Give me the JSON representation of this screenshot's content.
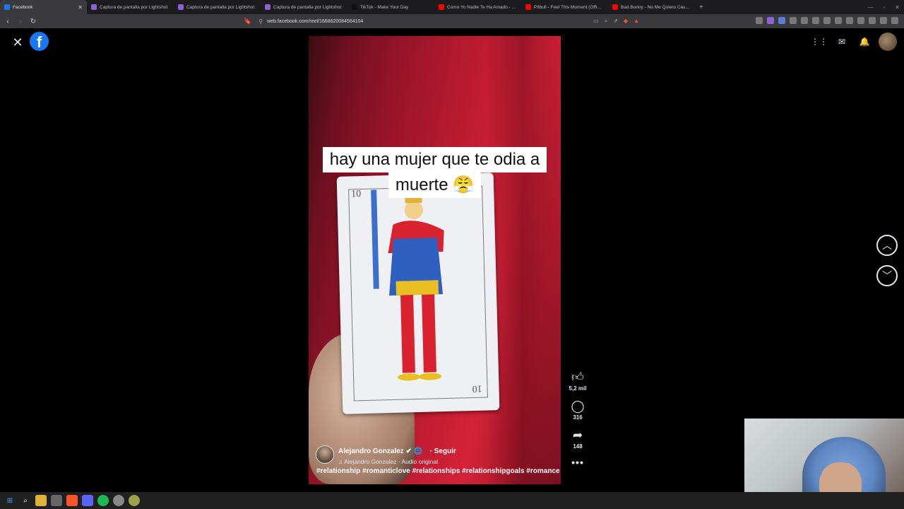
{
  "browser": {
    "tabs": [
      {
        "label": "Facebook",
        "active": true,
        "color": "#1877f2"
      },
      {
        "label": "Captura de pantalla por Lightshot",
        "active": false,
        "color": "#8a63d2"
      },
      {
        "label": "Captura de pantalla por Lightshot",
        "active": false,
        "color": "#8a63d2"
      },
      {
        "label": "Captura de pantalla por Lightshot",
        "active": false,
        "color": "#8a63d2"
      },
      {
        "label": "TikTok - Make Your Day",
        "active": false,
        "color": "#111111"
      },
      {
        "label": "Como Yo Nadie Te Ha Amado - YouT",
        "active": false,
        "color": "#ff0000"
      },
      {
        "label": "Pitbull - Feel This Moment (Official V",
        "active": false,
        "color": "#ff0000"
      },
      {
        "label": "Bad Bunny - No Me Quiero Casar (Le",
        "active": false,
        "color": "#ff0000"
      }
    ],
    "url": "web.facebook.com/reel/1668620084564104"
  },
  "reel": {
    "caption_line1": "hay una mujer que te odia a",
    "caption_line2": "muerte 😤",
    "card_number": "10",
    "author_name": "Alejandro Gonzalez ✔ 🌐",
    "follow_label": "· Seguir",
    "audio": "♫ Alejandro Gonzalez · Audio original",
    "hashtags": "#relationship #romanticlove #relationships #relationshipgoals #romance"
  },
  "actions": {
    "likes": "5,2 mil",
    "comments": "316",
    "shares": "148"
  },
  "colors": {
    "fb_blue": "#1877f2",
    "curtain_red": "#c01c32"
  }
}
